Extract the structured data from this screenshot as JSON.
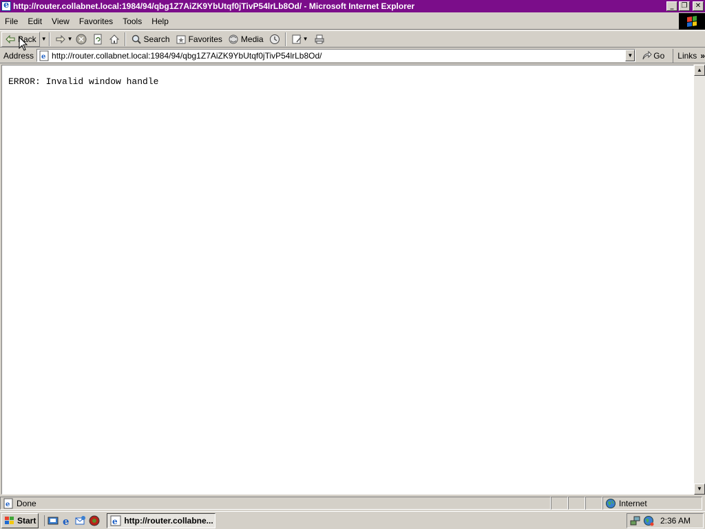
{
  "window": {
    "title": "http://router.collabnet.local:1984/94/qbg1Z7AiZK9YbUtqf0jTivP54lrLb8Od/ - Microsoft Internet Explorer",
    "app_icon": "ie-icon",
    "controls": {
      "minimize": "_",
      "maximize": "❐",
      "close": "✕"
    }
  },
  "menu": {
    "items": [
      "File",
      "Edit",
      "View",
      "Favorites",
      "Tools",
      "Help"
    ]
  },
  "toolbar": {
    "back_label": "Back",
    "search_label": "Search",
    "favorites_label": "Favorites",
    "media_label": "Media"
  },
  "address": {
    "label": "Address",
    "url": "http://router.collabnet.local:1984/94/qbg1Z7AiZK9YbUtqf0jTivP54lrLb8Od/",
    "go_label": "Go",
    "links_label": "Links",
    "links_chevron": "»"
  },
  "content": {
    "error_message": "ERROR: Invalid window handle"
  },
  "statusbar": {
    "status_text": "Done",
    "zone_text": "Internet"
  },
  "taskbar": {
    "start_label": "Start",
    "task_label": "http://router.collabne...",
    "clock": "2:36 AM"
  },
  "colors": {
    "titlebar_bg": "#7b0d8a",
    "chrome_bg": "#d4d0c8",
    "content_bg": "#ffffff"
  }
}
